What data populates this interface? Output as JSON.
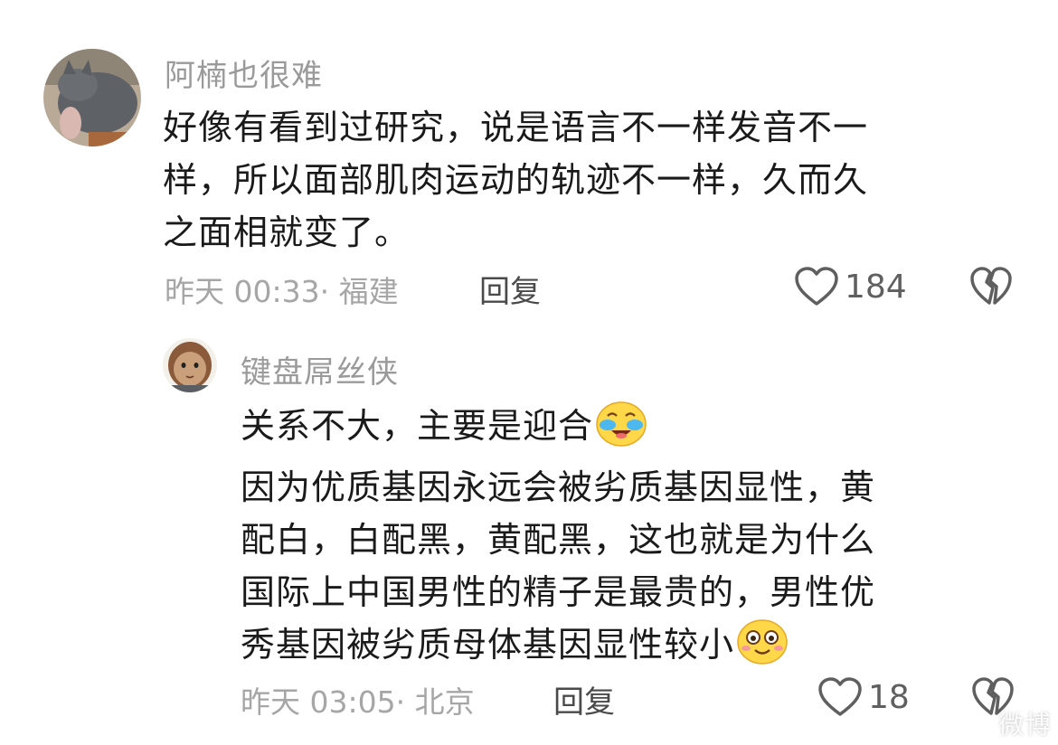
{
  "comments": [
    {
      "username": "阿楠也很难",
      "body_lines": [
        "好像有看到过研究，说是语言不一样发音不一",
        "样，所以面部肌肉运动的轨迹不一样，久而久",
        "之面相就变了。"
      ],
      "time": "昨天 00:33",
      "location": "· 福建",
      "reply_label": "回复",
      "like_count": "184"
    },
    {
      "username": "键盘屌丝侠",
      "body_lines": [
        "关系不大，主要是迎合",
        "因为优质基因永远会被劣质基因显性，黄",
        "配白，白配黑，黄配黑，这也就是为什么",
        "国际上中国男性的精子是最贵的，男性优",
        "秀基因被劣质母体基因显性较小"
      ],
      "emojis": [
        "tears-of-joy-emoji",
        "smiling-emoji"
      ],
      "time": "昨天 03:05",
      "location": "· 北京",
      "reply_label": "回复",
      "like_count": "18"
    }
  ],
  "watermark": "微博",
  "colors": {
    "username": "#9a9a9a",
    "body": "#1a1a1a",
    "meta": "#a6a6a6",
    "action": "#5f5f5f"
  }
}
